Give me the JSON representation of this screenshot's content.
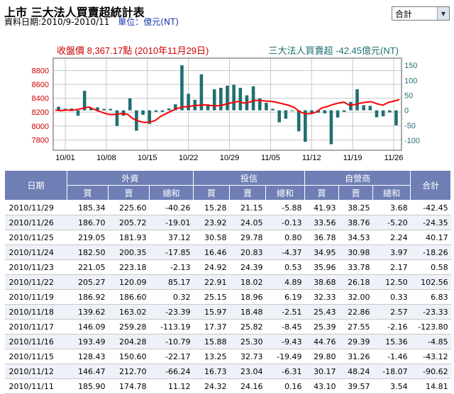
{
  "header": {
    "title": "上市 三大法人買賣超統計表",
    "date_range": "資料日期:2010/9-2010/11",
    "unit": "單位：億元(NT)",
    "dropdown_value": "合計"
  },
  "chart_labels": {
    "close_label": "收盤價 8,367.17點 (2010年11月29日)",
    "net_label": "三大法人買賣超 -42.45億元(NT)"
  },
  "colors": {
    "price_line": "#ff0000",
    "bars": "#1f6f72",
    "left_axis": "#cc0000",
    "right_axis": "#1f6f72",
    "grid": "#c8c8c8",
    "table_header": "#6f7fb5"
  },
  "chart_data": {
    "type": "bar+line",
    "x_tick_labels": [
      "10/01",
      "10/08",
      "10/15",
      "10/22",
      "10/29",
      "11/05",
      "11/12",
      "11/19",
      "11/26"
    ],
    "left_axis": {
      "ticks": [
        7800,
        8000,
        8200,
        8400,
        8600,
        8800
      ],
      "ylim": [
        7650,
        8980
      ]
    },
    "right_axis": {
      "ticks": [
        -100,
        -50,
        0,
        50,
        100,
        150
      ],
      "ylim": [
        -133,
        174
      ]
    },
    "grid": true,
    "series": [
      {
        "kind": "bar",
        "axis": "right",
        "values": [
          12,
          5,
          6,
          -18,
          65,
          8,
          10,
          5,
          5,
          -52,
          -18,
          40,
          -68,
          -15,
          -45,
          -5,
          -5,
          6,
          20,
          150,
          55,
          35,
          120,
          20,
          70,
          75,
          82,
          85,
          75,
          50,
          80,
          40,
          25,
          5,
          -40,
          -28,
          0,
          -70,
          -105,
          -12,
          -8,
          -10,
          -113,
          -24,
          -5,
          28,
          70,
          17,
          15,
          -23,
          -20,
          -7,
          -50
        ]
      },
      {
        "kind": "line",
        "axis": "left",
        "values": [
          8230,
          8220,
          8232,
          8225,
          8240,
          8255,
          8275,
          8240,
          8210,
          8180,
          8165,
          8170,
          8180,
          8170,
          8105,
          8070,
          8050,
          8055,
          8080,
          8140,
          8180,
          8220,
          8255,
          8275,
          8280,
          8295,
          8300,
          8305,
          8295,
          8290,
          8300,
          8320,
          8340,
          8355,
          8330,
          8345,
          8370,
          8367,
          8360,
          8355,
          8340,
          8320,
          8300,
          8270,
          8210,
          8175,
          8180,
          8200,
          8260,
          8280,
          8310,
          8330,
          8345,
          8300,
          8310,
          8330,
          8345,
          8350,
          8320,
          8300,
          8340,
          8360,
          8380
        ]
      }
    ]
  },
  "table": {
    "col_headers": {
      "date": "日期",
      "foreign": "外資",
      "trust": "投信",
      "dealer": "自營商",
      "total": "合計",
      "buy": "買",
      "sell": "賣",
      "sum": "總和"
    },
    "rows": [
      [
        "2010/11/29",
        "185.34",
        "225.60",
        "-40.26",
        "15.28",
        "21.15",
        "-5.88",
        "41.93",
        "38.25",
        "3.68",
        "-42.45"
      ],
      [
        "2010/11/26",
        "186.70",
        "205.72",
        "-19.01",
        "23.92",
        "24.05",
        "-0.13",
        "33.56",
        "38.76",
        "-5.20",
        "-24.35"
      ],
      [
        "2010/11/25",
        "219.05",
        "181.93",
        "37.12",
        "30.58",
        "29.78",
        "0.80",
        "36.78",
        "34.53",
        "2.24",
        "40.17"
      ],
      [
        "2010/11/24",
        "182.50",
        "200.35",
        "-17.85",
        "16.46",
        "20.83",
        "-4.37",
        "34.95",
        "30.98",
        "3.97",
        "-18.26"
      ],
      [
        "2010/11/23",
        "221.05",
        "223.18",
        "-2.13",
        "24.92",
        "24.39",
        "0.53",
        "35.96",
        "33.78",
        "2.17",
        "0.58"
      ],
      [
        "2010/11/22",
        "205.27",
        "120.09",
        "85.17",
        "22.91",
        "18.02",
        "4.89",
        "38.68",
        "26.18",
        "12.50",
        "102.56"
      ],
      [
        "2010/11/19",
        "186.92",
        "186.60",
        "0.32",
        "25.15",
        "18.96",
        "6.19",
        "32.33",
        "32.00",
        "0.33",
        "6.83"
      ],
      [
        "2010/11/18",
        "139.62",
        "163.02",
        "-23.39",
        "15.97",
        "18.48",
        "-2.51",
        "25.43",
        "22.86",
        "2.57",
        "-23.33"
      ],
      [
        "2010/11/17",
        "146.09",
        "259.28",
        "-113.19",
        "17.37",
        "25.82",
        "-8.45",
        "25.39",
        "27.55",
        "-2.16",
        "-123.80"
      ],
      [
        "2010/11/16",
        "193.49",
        "204.28",
        "-10.79",
        "15.88",
        "25.30",
        "-9.43",
        "44.76",
        "29.39",
        "15.36",
        "-4.85"
      ],
      [
        "2010/11/15",
        "128.43",
        "150.60",
        "-22.17",
        "13.25",
        "32.73",
        "-19.49",
        "29.80",
        "31.26",
        "-1.46",
        "-43.12"
      ],
      [
        "2010/11/12",
        "146.47",
        "212.70",
        "-66.24",
        "16.73",
        "23.04",
        "-6.31",
        "30.17",
        "48.24",
        "-18.07",
        "-90.62"
      ],
      [
        "2010/11/11",
        "185.90",
        "174.78",
        "11.12",
        "24.32",
        "24.16",
        "0.16",
        "43.10",
        "39.57",
        "3.54",
        "14.81"
      ]
    ]
  }
}
